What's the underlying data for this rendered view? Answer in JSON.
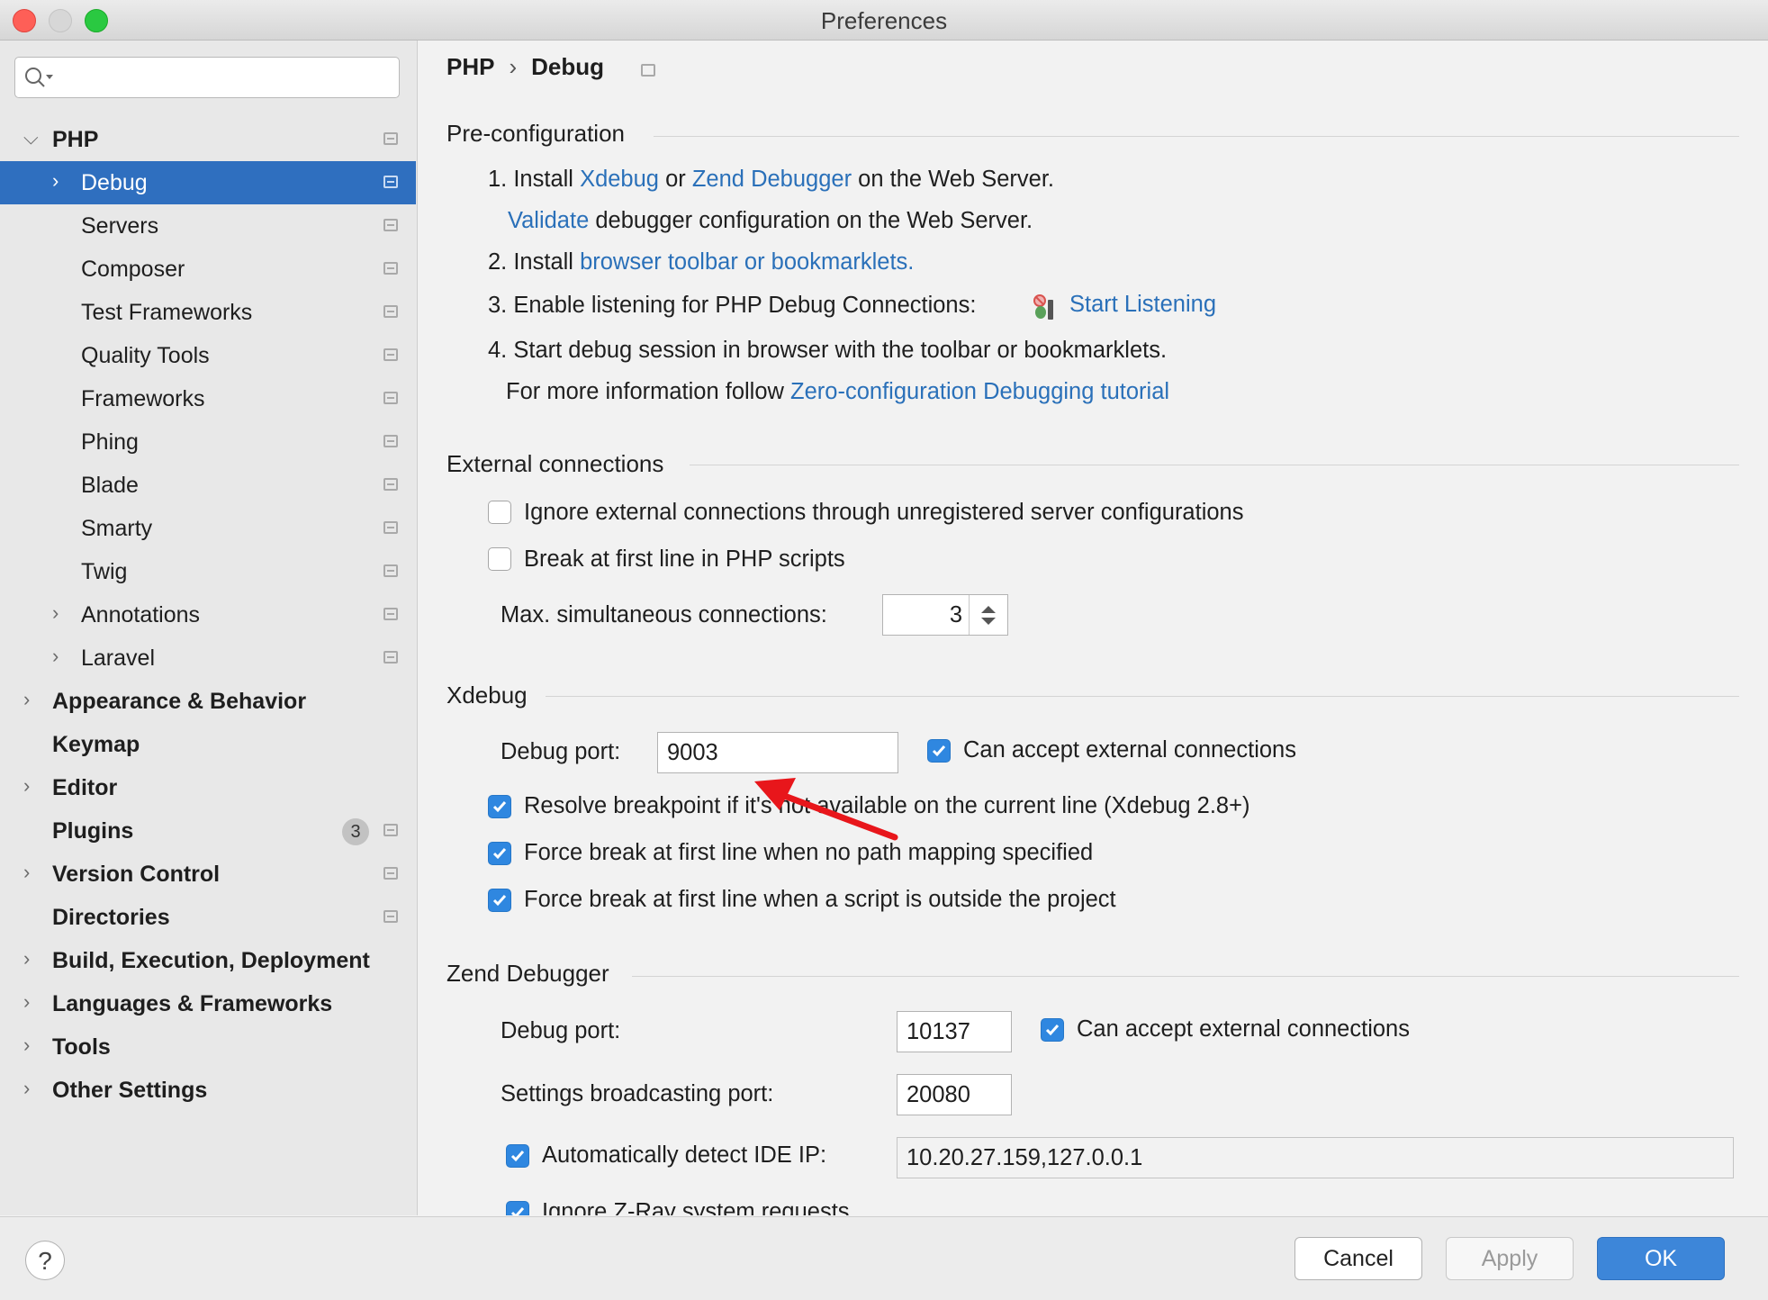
{
  "window": {
    "title": "Preferences"
  },
  "sidebar": {
    "search": {
      "value": "",
      "placeholder": ""
    },
    "items": [
      {
        "label": "PHP",
        "level": 0,
        "expanded": true,
        "bold": true
      },
      {
        "label": "Debug",
        "level": 1,
        "selected": true
      },
      {
        "label": "Servers",
        "level": 1
      },
      {
        "label": "Composer",
        "level": 1
      },
      {
        "label": "Test Frameworks",
        "level": 1
      },
      {
        "label": "Quality Tools",
        "level": 1
      },
      {
        "label": "Frameworks",
        "level": 1
      },
      {
        "label": "Phing",
        "level": 1
      },
      {
        "label": "Blade",
        "level": 1
      },
      {
        "label": "Smarty",
        "level": 1
      },
      {
        "label": "Twig",
        "level": 1
      },
      {
        "label": "Annotations",
        "level": 1
      },
      {
        "label": "Laravel",
        "level": 1
      },
      {
        "label": "Appearance & Behavior",
        "level": 0
      },
      {
        "label": "Keymap",
        "level": 0
      },
      {
        "label": "Editor",
        "level": 0
      },
      {
        "label": "Plugins",
        "level": 0,
        "badge": "3"
      },
      {
        "label": "Version Control",
        "level": 0
      },
      {
        "label": "Directories",
        "level": 0
      },
      {
        "label": "Build, Execution, Deployment",
        "level": 0
      },
      {
        "label": "Languages & Frameworks",
        "level": 0
      },
      {
        "label": "Tools",
        "level": 0
      },
      {
        "label": "Other Settings",
        "level": 0
      }
    ]
  },
  "breadcrumb": {
    "parent": "PHP",
    "separator": "›",
    "current": "Debug"
  },
  "preconfig": {
    "title": "Pre-configuration",
    "step1_prefix": "1. Install",
    "step1_link1": "Xdebug",
    "step1_or": "or",
    "step1_link2": "Zend Debugger",
    "step1_suffix": "on the Web Server.",
    "validate_link": "Validate",
    "validate_suffix": "debugger configuration on the Web Server.",
    "step2_prefix": "2. Install",
    "step2_link": "browser toolbar or bookmarklets.",
    "step3_prefix": "3. Enable listening for PHP Debug Connections:",
    "step3_link": "Start Listening",
    "step4": "4. Start debug session in browser with the toolbar or bookmarklets.",
    "more_prefix": "For more information follow",
    "more_link": "Zero-configuration Debugging tutorial"
  },
  "external": {
    "title": "External connections",
    "ignore_label": "Ignore external connections through unregistered server configurations",
    "ignore_checked": false,
    "break_label": "Break at first line in PHP scripts",
    "break_checked": false,
    "max_label": "Max. simultaneous connections:",
    "max_value": "3"
  },
  "xdebug": {
    "title": "Xdebug",
    "port_label": "Debug port:",
    "port_value": "9003",
    "accept_label": "Can accept external connections",
    "resolve_label": "Resolve breakpoint if it's not available on the current line (Xdebug 2.8+)",
    "force_mapping_label": "Force break at first line when no path mapping specified",
    "force_outside_label": "Force break at first line when a script is outside the project"
  },
  "zend": {
    "title": "Zend Debugger",
    "port_label": "Debug port:",
    "port_value": "10137",
    "accept_label": "Can accept external connections",
    "broadcast_label": "Settings broadcasting port:",
    "broadcast_value": "20080",
    "detect_label": "Automatically detect IDE IP:",
    "detect_value": "10.20.27.159,127.0.0.1",
    "ignore_zray_label": "Ignore Z-Ray system requests"
  },
  "buttons": {
    "help": "?",
    "cancel": "Cancel",
    "apply": "Apply",
    "ok": "OK"
  },
  "colors": {
    "accent": "#2f6fbf",
    "link": "#2a70b9",
    "annotation_arrow": "#e8161b"
  }
}
